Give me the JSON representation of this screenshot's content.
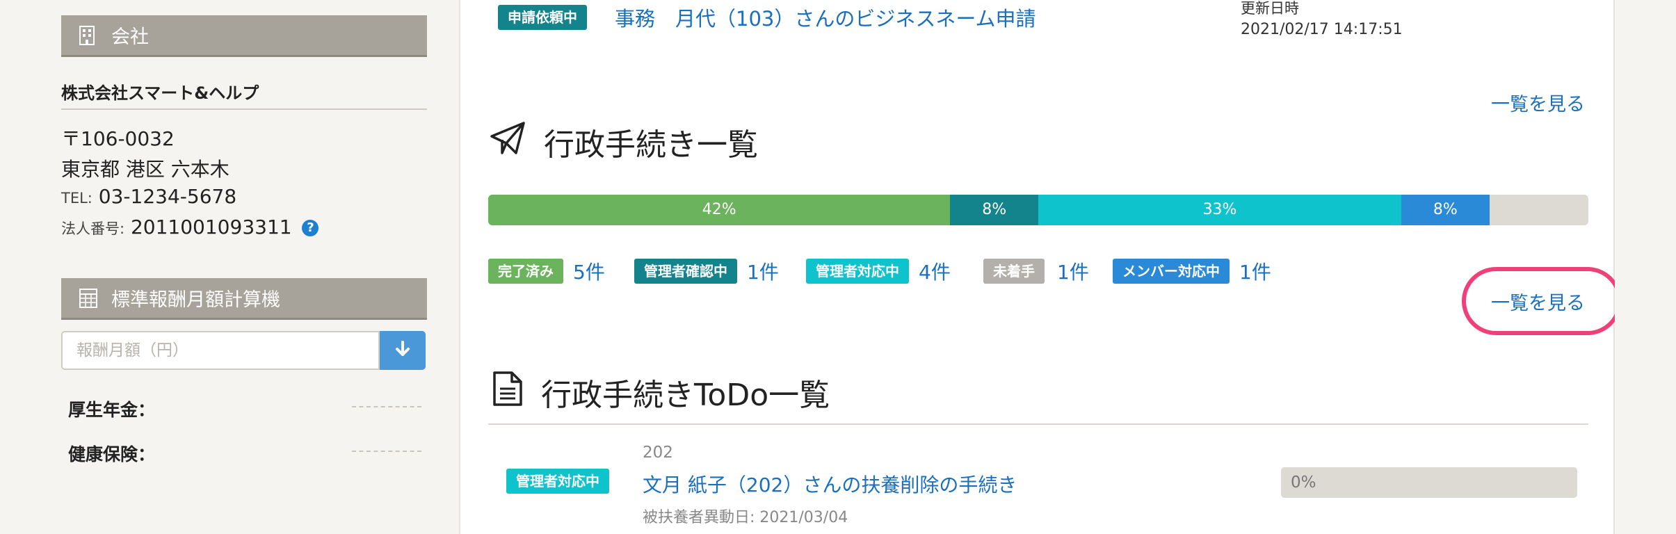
{
  "sidebar": {
    "company_section": {
      "title": "会社",
      "icon": "building-icon",
      "name": "株式会社スマート&ヘルプ",
      "postal": "〒106-0032",
      "address": "東京都 港区 六本木",
      "tel_label": "TEL:",
      "tel": "03-1234-5678",
      "corp_no_label": "法人番号:",
      "corp_no": "2011001093311",
      "help_icon": "question-circle-icon",
      "help_glyph": "?"
    },
    "calculator_section": {
      "title": "標準報酬月額計算機",
      "icon": "calculator-icon",
      "input_placeholder": "報酬月額（円）",
      "input_value": "",
      "button_icon": "arrow-down-icon",
      "pension_label": "厚生年金：",
      "health_label": "健康保険："
    }
  },
  "main": {
    "request": {
      "status_badge": "申請依頼中",
      "title": "事務　月代（103）さんのビジネスネーム申請",
      "updated_label": "更新日時",
      "updated_value": "2021/02/17 14:17:51"
    },
    "see_list_label": "一覧を見る",
    "admin_section": {
      "title": "行政手続き一覧",
      "icon": "paper-plane-icon",
      "progress_segments": [
        {
          "label": "42%",
          "value": 42,
          "color": "#6bb35c"
        },
        {
          "label": "8%",
          "value": 8,
          "color": "#13848c"
        },
        {
          "label": "33%",
          "value": 33,
          "color": "#0fc3cd"
        },
        {
          "label": "8%",
          "value": 8,
          "color": "#2a8ad8"
        },
        {
          "label": "",
          "value": 9,
          "color": "#ddd9d3"
        }
      ],
      "legend": [
        {
          "label": "完了済み",
          "count": "5件",
          "color": "#6bb35c"
        },
        {
          "label": "管理者確認中",
          "count": "1件",
          "color": "#13848c"
        },
        {
          "label": "管理者対応中",
          "count": "4件",
          "color": "#0fc3cd"
        },
        {
          "label": "未着手",
          "count": "1件",
          "color": "#b3b0ab"
        },
        {
          "label": "メンバー対応中",
          "count": "1件",
          "color": "#2a8ad8"
        }
      ]
    },
    "todo_section": {
      "title": "行政手続きToDo一覧",
      "icon": "document-icon",
      "item": {
        "status_badge": "管理者対応中",
        "employee_no": "202",
        "title": "文月 紙子（202）さんの扶養削除の手続き",
        "subtitle": "被扶養者異動日: 2021/03/04",
        "progress_label": "0%",
        "progress_value": 0
      }
    }
  },
  "colors": {
    "link": "#1a6fbf",
    "section_header": "#a8a39a",
    "highlight": "#f0407a",
    "badge_teal": "#13848c",
    "badge_cyan": "#0fc3cd"
  }
}
